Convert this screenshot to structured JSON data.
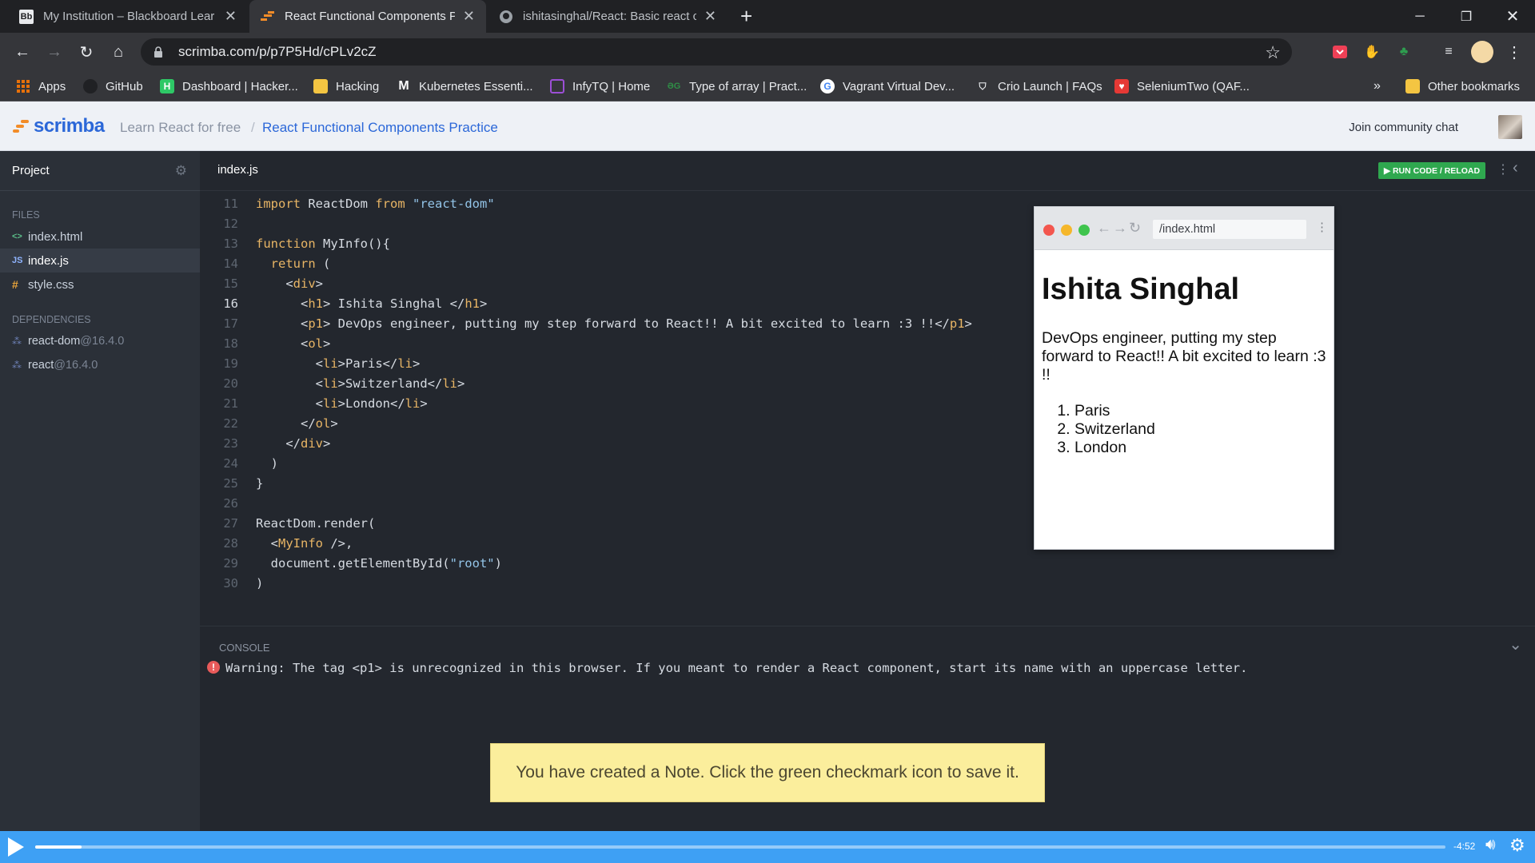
{
  "browser": {
    "tabs": [
      {
        "title": "My Institution – Blackboard Lear",
        "favicon": "Bb",
        "active": false
      },
      {
        "title": "React Functional Components Pr",
        "favicon": "scrimba",
        "active": true
      },
      {
        "title": "ishitasinghal/React: Basic react c",
        "favicon": "github",
        "active": false
      }
    ],
    "url": "scrimba.com/p/p7P5Hd/cPLv2cZ",
    "bookmarks": [
      {
        "label": "Apps"
      },
      {
        "label": "GitHub"
      },
      {
        "label": "Dashboard | Hacker..."
      },
      {
        "label": "Hacking"
      },
      {
        "label": "Kubernetes Essenti..."
      },
      {
        "label": "InfyTQ | Home"
      },
      {
        "label": "Type of array | Pract..."
      },
      {
        "label": "Vagrant Virtual Dev..."
      },
      {
        "label": "Crio Launch | FAQs"
      },
      {
        "label": "SeleniumTwo (QAF..."
      }
    ],
    "bookmarks_overflow": "»",
    "other_bookmarks": "Other bookmarks"
  },
  "scrimba": {
    "logo": "scrimba",
    "crumb_course": "Learn React for free",
    "crumb_sep": "/",
    "crumb_page": "React Functional Components Practice",
    "community": "Join community chat"
  },
  "sidebar": {
    "title": "Project",
    "files_heading": "FILES",
    "files": [
      {
        "icon": "<>",
        "name": "index.html",
        "active": false
      },
      {
        "icon": "JS",
        "name": "index.js",
        "active": true
      },
      {
        "icon": "#",
        "name": "style.css",
        "active": false
      }
    ],
    "deps_heading": "DEPENDENCIES",
    "deps": [
      {
        "name": "react-dom",
        "version": "@16.4.0"
      },
      {
        "name": "react",
        "version": "@16.4.0"
      }
    ]
  },
  "editor": {
    "filename": "index.js",
    "run_label": "▶ RUN CODE / RELOAD",
    "current_line": 16,
    "lines": [
      {
        "n": "11",
        "code": "import ReactDom from \"react-dom\""
      },
      {
        "n": "12",
        "code": ""
      },
      {
        "n": "13",
        "code": "function MyInfo(){"
      },
      {
        "n": "14",
        "code": "  return ("
      },
      {
        "n": "15",
        "code": "    <div>"
      },
      {
        "n": "16",
        "code": "      <h1> Ishita Singhal </h1>"
      },
      {
        "n": "17",
        "code": "      <p1> DevOps engineer, putting my step forward to React!! A bit excited to learn :3 !!</p1>"
      },
      {
        "n": "18",
        "code": "      <ol>"
      },
      {
        "n": "19",
        "code": "        <li>Paris</li>"
      },
      {
        "n": "20",
        "code": "        <li>Switzerland</li>"
      },
      {
        "n": "21",
        "code": "        <li>London</li>"
      },
      {
        "n": "22",
        "code": "      </ol>"
      },
      {
        "n": "23",
        "code": "    </div>"
      },
      {
        "n": "24",
        "code": "  )"
      },
      {
        "n": "25",
        "code": "}"
      },
      {
        "n": "26",
        "code": ""
      },
      {
        "n": "27",
        "code": "ReactDom.render("
      },
      {
        "n": "28",
        "code": "  <MyInfo />,"
      },
      {
        "n": "29",
        "code": "  document.getElementById(\"root\")"
      },
      {
        "n": "30",
        "code": ")"
      }
    ]
  },
  "preview": {
    "url": "/index.html",
    "heading": "Ishita Singhal",
    "paragraph": "DevOps engineer, putting my step forward to React!! A bit excited to learn :3 !!",
    "list": [
      "Paris",
      "Switzerland",
      "London"
    ]
  },
  "console": {
    "label": "CONSOLE",
    "message": "Warning: The tag <p1> is unrecognized in this browser. If you meant to render a React component, start its name with an uppercase letter."
  },
  "note_toast": "You have created a Note. Click the green checkmark icon to save it.",
  "player": {
    "time_remaining": "-4:52",
    "progress": 0.033
  },
  "colors": {
    "run_button": "#2fa84f",
    "player_bar": "#3ea0f4",
    "note_bg": "#fbee9c",
    "scrimba_blue": "#2b67d8"
  }
}
